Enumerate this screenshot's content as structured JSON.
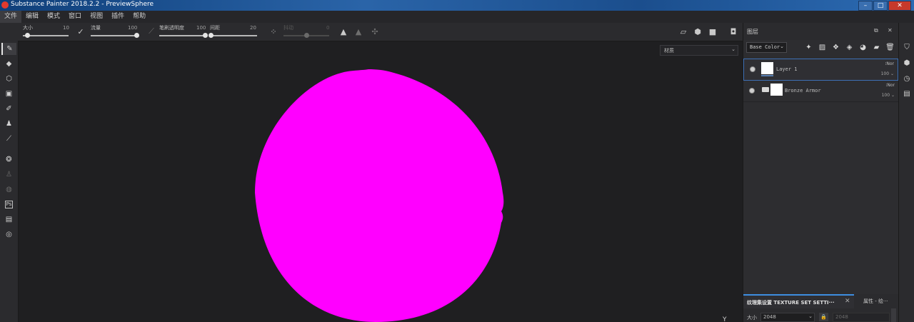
{
  "window": {
    "title": "Substance Painter 2018.2.2 - PreviewSphere",
    "buttons": [
      "–",
      "□",
      "✕"
    ]
  },
  "menu": {
    "items": [
      "文件",
      "编辑",
      "模式",
      "窗口",
      "视图",
      "插件",
      "帮助"
    ]
  },
  "toolbar": {
    "size_label": "大小",
    "size_value": "10",
    "size_fraction": 0.1,
    "flow_label": "流量",
    "flow_value": "100",
    "flow_fraction": 1.0,
    "opacity_label": "笔刷透明度",
    "opacity_value": "100",
    "opacity_fraction": 1.0,
    "spacing_label": "间距",
    "spacing_value": "20",
    "spacing_fraction": 0.02,
    "jitter_label": "抖动",
    "jitter_value": "0",
    "jitter_fraction": 0.5
  },
  "viewport": {
    "material_dropdown": "材质",
    "axis_label": "Y",
    "sphere_color": "#ff00ff"
  },
  "layers_panel": {
    "title": "图层",
    "channel": "Base Color",
    "layers": [
      {
        "name": "Layer 1",
        "blend": "Nor",
        "opacity": "100",
        "type": "paint",
        "selected": true
      },
      {
        "name": "Bronze Armor",
        "blend": "Nor",
        "opacity": "100",
        "type": "folder",
        "selected": false
      }
    ]
  },
  "texture_set": {
    "tab_label": "纹理集设置 TEXTURE SET SETTI···",
    "other_tab": "属性 - 绘···",
    "size_label": "大小",
    "size_value": "2048",
    "size_value_2": "2048"
  },
  "colors": {
    "accent": "#3d8de0",
    "sphere": "#ff00ff",
    "background": "#1f1f21"
  }
}
